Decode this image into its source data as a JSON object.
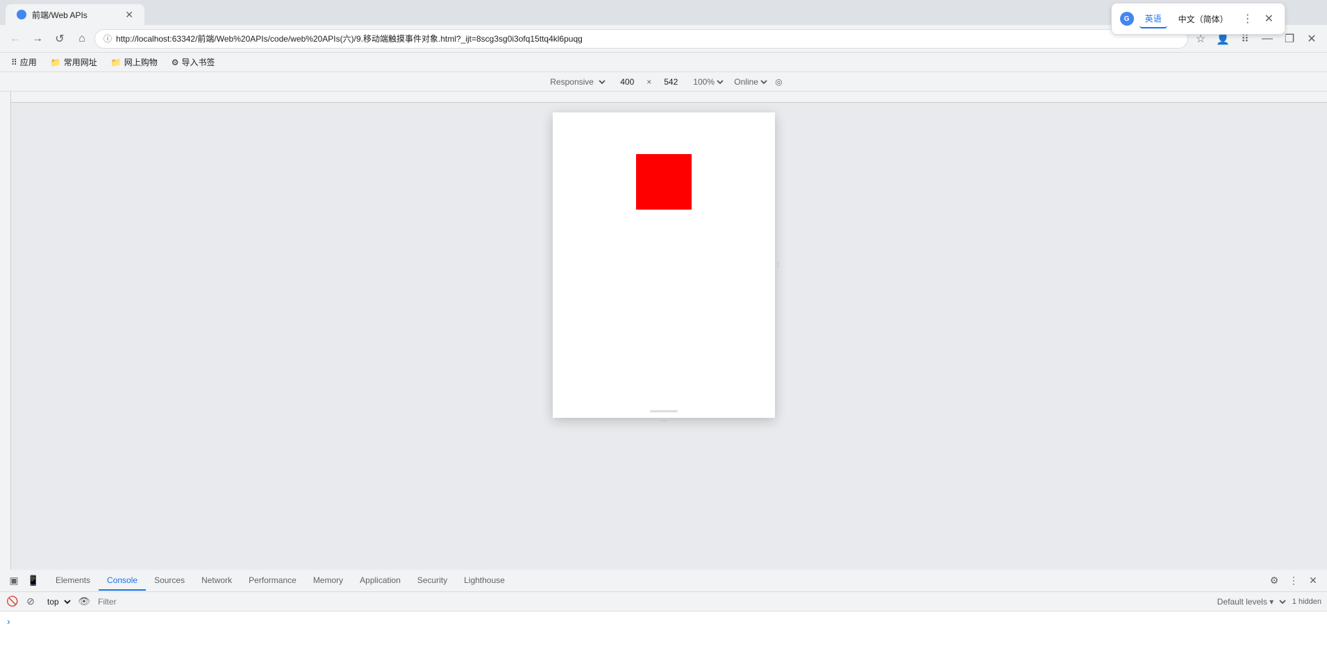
{
  "browser": {
    "url": "http://localhost:63342/前端/Web%20APIs/code/web%20APIs(六)/9.移动端触摸事件对象.html?_ijt=8scg3sg0i3ofq15ttq4kl6puqg",
    "tab_title": "前端/Web APIs"
  },
  "bookmarks": {
    "items": [
      {
        "label": "应用",
        "icon": "⠿"
      },
      {
        "label": "常用网址",
        "icon": "📁"
      },
      {
        "label": "网上购物",
        "icon": "📁"
      },
      {
        "label": "导入书签",
        "icon": "⚙"
      }
    ]
  },
  "responsive_toolbar": {
    "responsive_label": "Responsive ▾",
    "width": "400",
    "x": "×",
    "height": "542",
    "zoom": "100% ▾",
    "network": "Online ▾"
  },
  "translate_popup": {
    "icon_text": "G",
    "btn_active": "英语",
    "btn_inactive": "中文（简体）",
    "more_icon": "⋮",
    "close_icon": "✕"
  },
  "devtools": {
    "tabs": [
      {
        "id": "elements",
        "label": "Elements"
      },
      {
        "id": "console",
        "label": "Console",
        "active": true
      },
      {
        "id": "sources",
        "label": "Sources"
      },
      {
        "id": "network",
        "label": "Network"
      },
      {
        "id": "performance",
        "label": "Performance"
      },
      {
        "id": "memory",
        "label": "Memory"
      },
      {
        "id": "application",
        "label": "Application"
      },
      {
        "id": "security",
        "label": "Security"
      },
      {
        "id": "lighthouse",
        "label": "Lighthouse"
      }
    ],
    "settings_icon": "⚙",
    "more_icon": "⋮",
    "close_icon": "✕"
  },
  "console_toolbar": {
    "context": "top",
    "context_arrow": "▾",
    "filter_placeholder": "Filter",
    "levels": "Default levels ▾",
    "hidden_count": "1 hidden"
  },
  "console_content": {
    "prompt_icon": "›"
  },
  "nav": {
    "back_icon": "←",
    "forward_icon": "→",
    "reload_icon": "↺",
    "home_icon": "⌂",
    "bookmark_icon": "☆",
    "more_icon": "⋮",
    "profile_icon": "👤",
    "extensions_icon": "⠿",
    "minimize_icon": "—",
    "maximize_icon": "❐",
    "close_icon": "✕"
  },
  "colors": {
    "red_box": "#ff0000",
    "active_tab": "#1a73e8",
    "bg": "#e8eaed"
  }
}
